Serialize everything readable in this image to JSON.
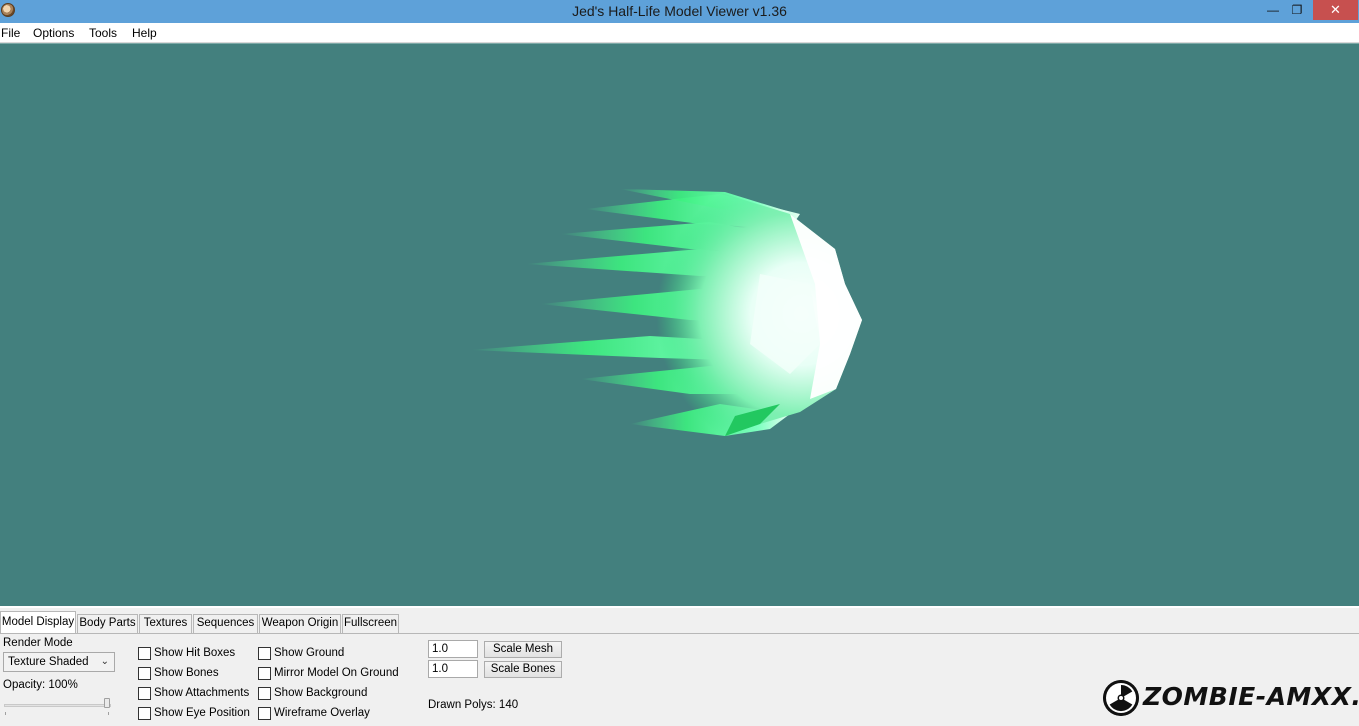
{
  "window": {
    "title": "Jed's Half-Life Model Viewer v1.36",
    "min_glyph": "—",
    "max_glyph": "❐",
    "close_glyph": "✕"
  },
  "menu": [
    "File",
    "Options",
    "Tools",
    "Help"
  ],
  "viewport": {
    "background_color": "#43807e"
  },
  "tabs": [
    "Model Display",
    "Body Parts",
    "Textures",
    "Sequences",
    "Weapon Origin",
    "Fullscreen"
  ],
  "model_display": {
    "render_mode_label": "Render Mode",
    "render_mode_value": "Texture Shaded",
    "opacity_label": "Opacity: 100%",
    "opacity_value": 1.0,
    "checkboxes_col1": [
      "Show Hit Boxes",
      "Show Bones",
      "Show Attachments",
      "Show Eye Position"
    ],
    "checkboxes_col2": [
      "Show Ground",
      "Mirror Model On Ground",
      "Show Background",
      "Wireframe Overlay"
    ],
    "scale_mesh_value": "1.0",
    "scale_mesh_button": "Scale Mesh",
    "scale_bones_value": "1.0",
    "scale_bones_button": "Scale Bones",
    "drawn_polys": "Drawn Polys: 140"
  },
  "watermark": {
    "text": "ZOMBIE-AMXX.RU"
  },
  "icons": {
    "app": "half-life-app-icon",
    "watermark": "radiation-icon"
  }
}
